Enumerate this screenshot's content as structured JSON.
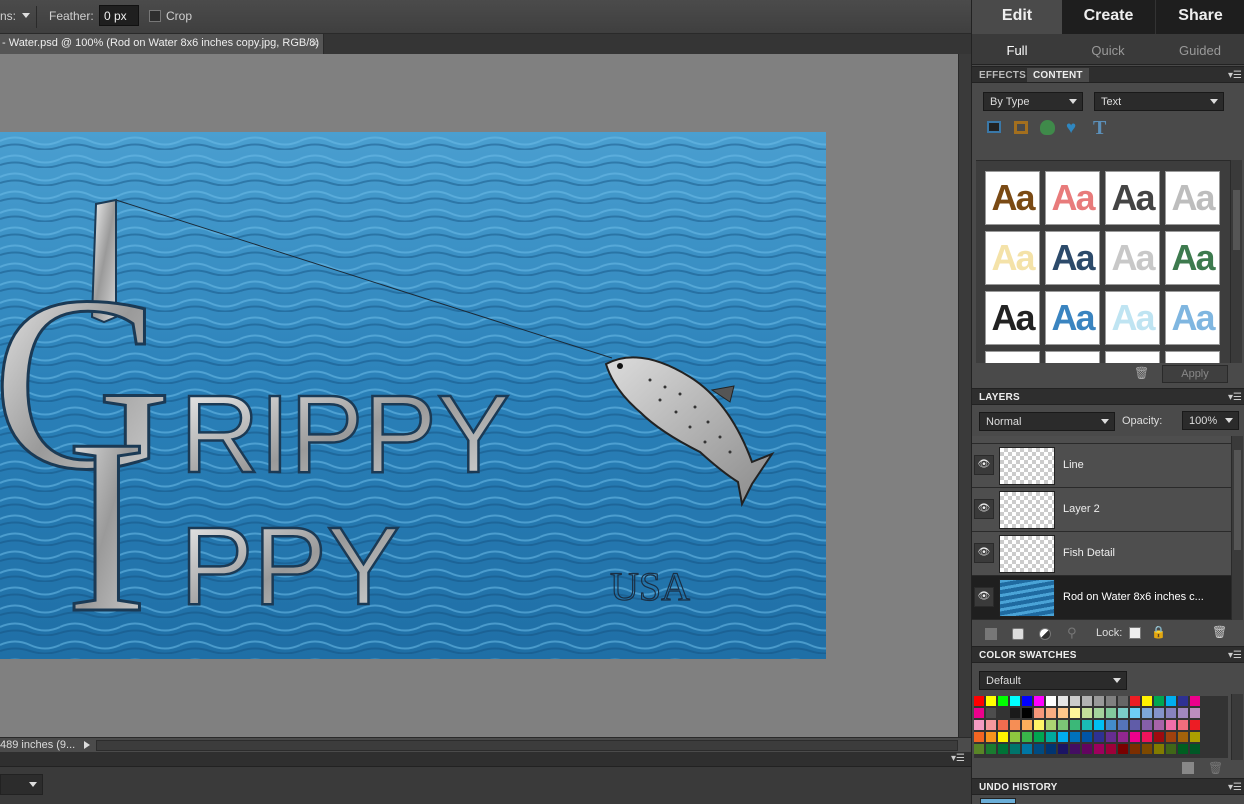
{
  "options_bar": {
    "left_label": "ns:",
    "feather_label": "Feather:",
    "feather_value": "0 px",
    "crop_label": "Crop"
  },
  "document_tab": {
    "title": "- Water.psd @ 100% (Rod on Water 8x6 inches copy.jpg, RGB/8)",
    "close": "×"
  },
  "artwork": {
    "big_letter_top": "G",
    "big_letter_bottom": "I",
    "word_top": "RIPPY",
    "word_bottom": "PPY",
    "country": "USA"
  },
  "status_bar": {
    "text": "489 inches (9..."
  },
  "mode_tabs": {
    "edit": "Edit",
    "create": "Create",
    "share": "Share"
  },
  "sub_tabs": {
    "full": "Full",
    "quick": "Quick",
    "guided": "Guided"
  },
  "content_panel": {
    "tab_effects": "EFFECTS",
    "tab_content": "CONTENT",
    "filter_by": "By Type",
    "filter_kind": "Text",
    "thumb_label": "Aa",
    "apply_label": "Apply"
  },
  "layers_panel": {
    "title": "LAYERS",
    "blend_mode": "Normal",
    "opacity_label": "Opacity:",
    "opacity_value": "100%",
    "lock_label": "Lock:",
    "layers": [
      {
        "name": "Line"
      },
      {
        "name": "Layer 2"
      },
      {
        "name": "Fish Detail"
      },
      {
        "name": "Rod on Water 8x6 inches c..."
      }
    ]
  },
  "swatches_panel": {
    "title": "COLOR SWATCHES",
    "preset": "Default",
    "colors": [
      [
        "#ff0000",
        "#ffff00",
        "#00ff00",
        "#00ffff",
        "#0000ff",
        "#ff00ff",
        "#ffffff",
        "#e6e6e6",
        "#cccccc",
        "#b3b3b3",
        "#999999",
        "#808080",
        "#666666",
        "#ed1c24",
        "#fff200",
        "#00a651",
        "#00aeef",
        "#2e3192",
        "#ec008c"
      ],
      [
        "#ec008c",
        "#4d4d4d",
        "#333333",
        "#1a1a1a",
        "#000000",
        "#f7977a",
        "#f9ad81",
        "#fdc68a",
        "#fff79a",
        "#c4df9b",
        "#a3d39c",
        "#82ca9d",
        "#7bcdc8",
        "#6ecff6",
        "#7ea7d8",
        "#8493ca",
        "#8882be",
        "#a187be",
        "#bc8dbf"
      ],
      [
        "#f49ac2",
        "#f6989d",
        "#f26c4f",
        "#f68e55",
        "#fbaf5c",
        "#fff467",
        "#acd372",
        "#7cc576",
        "#3bb878",
        "#1abbb4",
        "#00bff3",
        "#438cca",
        "#5574b9",
        "#605ca8",
        "#855fa8",
        "#a763a8",
        "#f06ea9",
        "#f26d7d",
        "#ed1c24"
      ],
      [
        "#f26522",
        "#f7941d",
        "#fff200",
        "#8dc63f",
        "#39b54a",
        "#00a651",
        "#00a99d",
        "#00aeef",
        "#0072bc",
        "#0054a6",
        "#2e3192",
        "#662d91",
        "#92278f",
        "#ec008c",
        "#ed145b",
        "#9e0b0f",
        "#a0410d",
        "#a3620a",
        "#aba000"
      ],
      [
        "#598527",
        "#1a7b30",
        "#007236",
        "#00746b",
        "#0076a3",
        "#004b80",
        "#003471",
        "#1b1464",
        "#440e62",
        "#630460",
        "#9e005d",
        "#9e0039",
        "#790000",
        "#7b2e00",
        "#7d4900",
        "#827b00",
        "#406618",
        "#005e20",
        "#005826"
      ]
    ]
  },
  "undo_panel": {
    "title": "UNDO HISTORY"
  }
}
